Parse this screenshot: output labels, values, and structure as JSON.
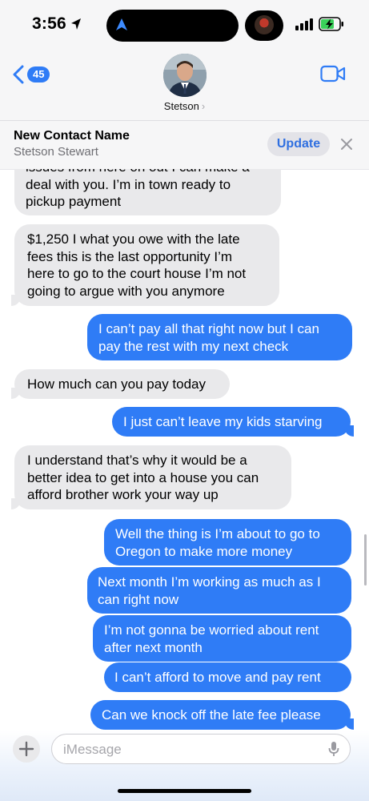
{
  "status_bar": {
    "time": "3:56",
    "icons": [
      "location-arrow-icon",
      "navigation-arrow-icon",
      "signal-icon",
      "battery-charging-icon"
    ]
  },
  "header": {
    "back_count": "45",
    "contact_name": "Stetson",
    "chevron": "›"
  },
  "banner": {
    "title": "New Contact Name",
    "subtitle": "Stetson Stewart",
    "update_label": "Update",
    "close_icon": "×"
  },
  "messages": [
    {
      "from": "them",
      "text": "issues from here on out I can make a\ndeal with you. I’m in town ready to\npickup payment"
    },
    {
      "from": "them",
      "text": "$1,250 I what you owe with the late\nfees this is the last opportunity I’m\nhere to go to the court house I’m not\ngoing to argue with you anymore"
    },
    {
      "from": "me",
      "text": "I can’t pay all that right now but I can\npay the rest with my next check"
    },
    {
      "from": "them",
      "text": "How much can you pay today"
    },
    {
      "from": "me",
      "text": "I just can’t leave my kids starving"
    },
    {
      "from": "them",
      "text": "I understand that’s why it would be a\nbetter idea to get into a house you can\nafford brother work your way up"
    },
    {
      "from": "me",
      "text": "Well the thing is I’m about to go to\nOregon to make more money"
    },
    {
      "from": "me",
      "text": "Next month I’m working as much as I\ncan right now"
    },
    {
      "from": "me",
      "text": "I’m not gonna be worried about rent\nafter next month"
    },
    {
      "from": "me",
      "text": "I can’t afford to move and pay rent"
    },
    {
      "from": "me",
      "text": "Can we knock off the late fee please"
    }
  ],
  "composer": {
    "placeholder": "iMessage"
  },
  "colors": {
    "sent_bubble": "#2f7cf6",
    "received_bubble": "#e9e9eb",
    "accent": "#2f7cf6"
  }
}
